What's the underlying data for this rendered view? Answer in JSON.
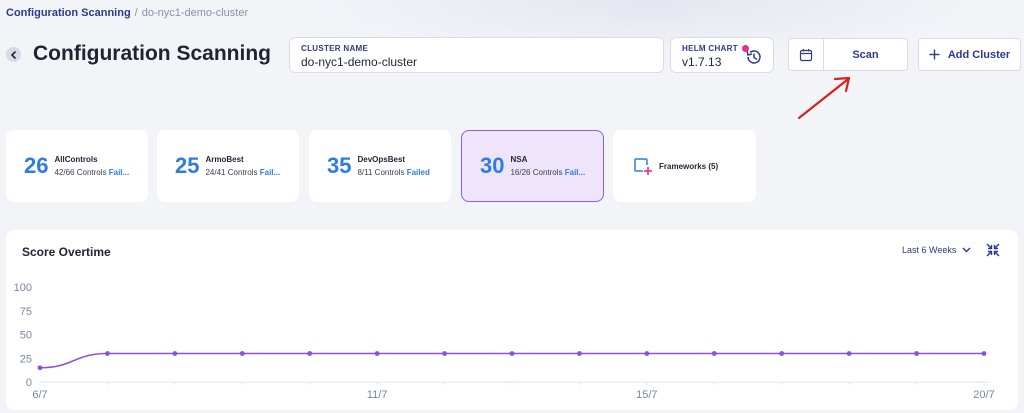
{
  "breadcrumb": {
    "main": "Configuration Scanning",
    "sep": "/",
    "current": "do-nyc1-demo-cluster"
  },
  "page": {
    "title": "Configuration Scanning"
  },
  "cluster": {
    "label": "CLUSTER NAME",
    "value": "do-nyc1-demo-cluster"
  },
  "helm": {
    "label": "HELM CHART",
    "value": "v1.7.13"
  },
  "actions": {
    "scan_label": "Scan",
    "add_cluster_label": "Add Cluster"
  },
  "frameworks": [
    {
      "score": "26",
      "name": "AllControls",
      "controls": "42/66 Controls",
      "status": "Fail..."
    },
    {
      "score": "25",
      "name": "ArmoBest",
      "controls": "24/41 Controls",
      "status": "Fail..."
    },
    {
      "score": "35",
      "name": "DevOpsBest",
      "controls": "8/11 Controls",
      "status": "Failed"
    },
    {
      "score": "30",
      "name": "NSA",
      "controls": "16/26 Controls",
      "status": "Fail..."
    }
  ],
  "frameworks_more": {
    "label": "Frameworks (5)"
  },
  "score_chart": {
    "title": "Score Overtime",
    "range": "Last 6 Weeks"
  },
  "colors": {
    "accent": "#2b3a8c",
    "score": "#2e7be6",
    "line": "#8c4fe0",
    "active_bg": "#eee4fb",
    "arrow": "#d9201c"
  },
  "chart_data": {
    "type": "line",
    "title": "Score Overtime",
    "xlabel": "",
    "ylabel": "",
    "ylim": [
      0,
      100
    ],
    "yticks": [
      0,
      25,
      50,
      75,
      100
    ],
    "x_tick_labels": [
      "6/7",
      "11/7",
      "15/7",
      "20/7"
    ],
    "x": [
      "6/7",
      "7/7",
      "8/7",
      "9/7",
      "10/7",
      "11/7",
      "12/7",
      "13/7",
      "14/7",
      "15/7",
      "16/7",
      "17/7",
      "18/7",
      "19/7",
      "20/7"
    ],
    "series": [
      {
        "values": [
          15,
          30,
          30,
          30,
          30,
          30,
          30,
          30,
          30,
          30,
          30,
          30,
          30,
          30,
          30
        ]
      }
    ],
    "grid": false
  }
}
